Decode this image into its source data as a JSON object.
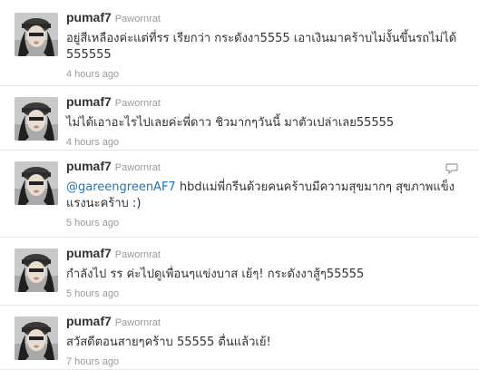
{
  "tweets": [
    {
      "screen_name": "pumaf7",
      "full_name": "Pawornrat",
      "text": "อยู่สีเหลืองค่ะแต่ที่รร เรียกว่า กระดังงา5555 เอาเงินมาคร้าบไม่งั้นขึ้นรถไม่ได้ 555555",
      "timestamp": "4 hours ago"
    },
    {
      "screen_name": "pumaf7",
      "full_name": "Pawornrat",
      "text": "ไม่ได้เอาอะไรไปเลยค่ะพี่ดาว ชิวมากๆวันนี้ มาตัวเปล่าเลย55555",
      "timestamp": "4 hours ago"
    },
    {
      "screen_name": "pumaf7",
      "full_name": "Pawornrat",
      "mention": "@gareengreenAF7",
      "text": " hbdแม่พี่กรีนด้วยคนคร้าบมีความสุขมากๆ สุขภาพแข็งแรงนะคร้าบ :)",
      "timestamp": "5 hours ago",
      "reply_icon": "reply-bubble-icon"
    },
    {
      "screen_name": "pumaf7",
      "full_name": "Pawornrat",
      "text": "กำลังไป รร ค่ะไปดูเพื่อนๆแข่งบาส เย้ๆ! กระดังงาสู้ๆ55555",
      "timestamp": "5 hours ago"
    },
    {
      "screen_name": "pumaf7",
      "full_name": "Pawornrat",
      "text": "สวัสดีตอนสายๆคร้าบ 55555 ตื่นแล้วเย้!",
      "timestamp": "7 hours ago"
    }
  ]
}
